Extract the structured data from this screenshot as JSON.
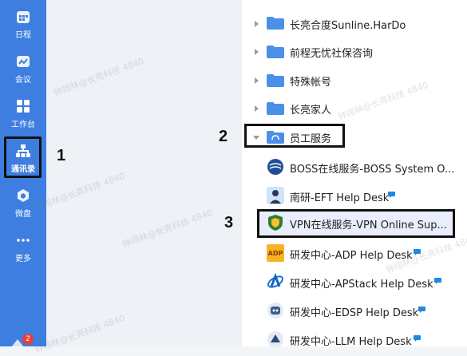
{
  "nav": {
    "items": [
      {
        "label": "日程",
        "icon": "calendar-icon"
      },
      {
        "label": "会议",
        "icon": "meeting-icon"
      },
      {
        "label": "工作台",
        "icon": "workbench-icon"
      },
      {
        "label": "通讯录",
        "icon": "contacts-icon"
      },
      {
        "label": "微盘",
        "icon": "cloud-drive-icon"
      },
      {
        "label": "更多",
        "icon": "more-icon"
      }
    ],
    "badge": "2"
  },
  "tree": {
    "folders": [
      {
        "label": "长亮合度Sunline.HarDo"
      },
      {
        "label": "前程无忧社保咨询"
      },
      {
        "label": "特殊帐号"
      },
      {
        "label": "长亮家人"
      },
      {
        "label": "员工服务"
      }
    ],
    "services": [
      {
        "label": "BOSS在线服务-BOSS System O..."
      },
      {
        "label": "南研-EFT Help Desk"
      },
      {
        "label": "VPN在线服务-VPN Online Sup..."
      },
      {
        "label": "研发中心-ADP Help Desk"
      },
      {
        "label": "研发中心-APStack Help Desk"
      },
      {
        "label": "研发中心-EDSP Help Desk"
      },
      {
        "label": "研发中心-LLM Help Desk"
      }
    ]
  },
  "annotations": [
    "1",
    "2",
    "3"
  ],
  "watermark": "钟翊林@长亮科技 4840",
  "colors": {
    "nav_bg": "#3d7ee0",
    "folder": "#4a90e8",
    "highlight_row": "#e8eefb"
  }
}
